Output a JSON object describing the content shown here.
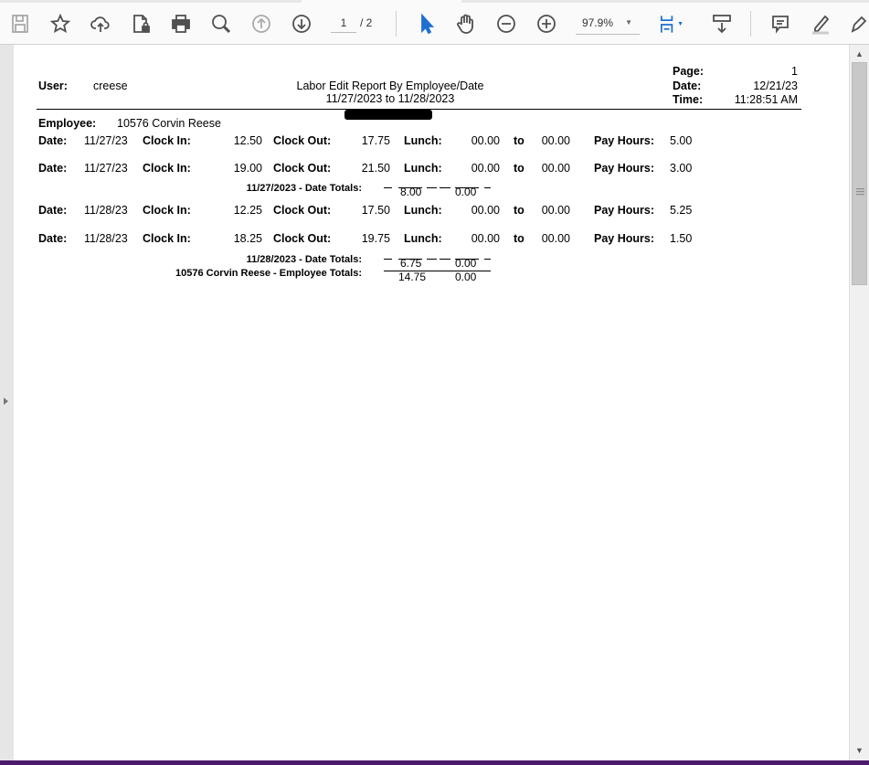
{
  "toolbar": {
    "page_current": "1",
    "page_total": "/ 2",
    "zoom": "97.9%",
    "icons": [
      "save-icon",
      "bookmark-star-icon",
      "upload-cloud-icon",
      "protect-document-icon",
      "print-icon",
      "search-zoom-icon",
      "previous-page-icon",
      "next-page-icon",
      "select-cursor-icon",
      "hand-tool-icon",
      "zoom-out-icon",
      "zoom-in-icon",
      "fit-page-icon",
      "read-mode-icon",
      "comment-icon",
      "highlight-icon",
      "sign-icon"
    ]
  },
  "report": {
    "user_label": "User:",
    "user": "creese",
    "title": "Labor Edit Report By Employee/Date",
    "date_range": "11/27/2023 to 11/28/2023",
    "page_label": "Page:",
    "page": "1",
    "date_label": "Date:",
    "date": "12/21/23",
    "time_label": "Time:",
    "time": "11:28:51 AM",
    "employee_label": "Employee:",
    "employee": "10576 Corvin Reese",
    "labels": {
      "date": "Date:",
      "clock_in": "Clock In:",
      "clock_out": "Clock  Out:",
      "lunch": "Lunch:",
      "to": "to",
      "pay_hours": "Pay Hours:"
    },
    "rows": [
      {
        "date": "11/27/23",
        "in": "12.50",
        "out": "17.75",
        "lunch_from": "00.00",
        "lunch_to": "00.00",
        "pay": "5.00"
      },
      {
        "date": "11/27/23",
        "in": "19.00",
        "out": "21.50",
        "lunch_from": "00.00",
        "lunch_to": "00.00",
        "pay": "3.00"
      },
      {
        "date": "11/28/23",
        "in": "12.25",
        "out": "17.50",
        "lunch_from": "00.00",
        "lunch_to": "00.00",
        "pay": "5.25"
      },
      {
        "date": "11/28/23",
        "in": "18.25",
        "out": "19.75",
        "lunch_from": "00.00",
        "lunch_to": "00.00",
        "pay": "1.50"
      }
    ],
    "totals": [
      {
        "label": "11/27/2023 - Date Totals:",
        "hours": "8.00",
        "lunch": "0.00"
      },
      {
        "label": "11/28/2023 - Date Totals:",
        "hours": "6.75",
        "lunch": "0.00"
      },
      {
        "label": "10576 Corvin Reese - Employee Totals:",
        "hours": "14.75",
        "lunch": "0.00"
      }
    ]
  }
}
